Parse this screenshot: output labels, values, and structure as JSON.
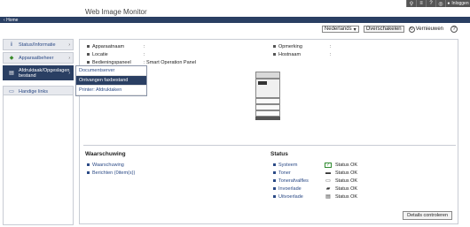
{
  "header": {
    "title": "Web Image Monitor",
    "login_label": "Inloggen"
  },
  "breadcrumb": {
    "home_label": "Home"
  },
  "controls": {
    "language_value": "Nederlands",
    "switch_label": "Overschakelen",
    "refresh_label": "Vernieuwen"
  },
  "sidebar": {
    "items": [
      {
        "label": "Status/Informatie",
        "icon": "info-icon"
      },
      {
        "label": "Apparaatbeheer",
        "icon": "device-management-icon"
      },
      {
        "label": "Afdruktaak/Opgeslagen bestand",
        "icon": "print-job-icon"
      },
      {
        "label": "Handige links",
        "icon": "links-icon"
      }
    ]
  },
  "submenu": {
    "items": [
      {
        "label": "Documentserver"
      },
      {
        "label": "Ontvangen faxbestand"
      },
      {
        "label": "Printer: Afdruktaken"
      }
    ]
  },
  "device_info": {
    "left": [
      {
        "label": "Apparaatnaam",
        "value": ":"
      },
      {
        "label": "Locatie",
        "value": ":"
      },
      {
        "label": "Bedieningspaneel",
        "value": ": Smart Operation Panel"
      }
    ],
    "right": [
      {
        "label": "Opmerking",
        "value": ":"
      },
      {
        "label": "Hostnaam",
        "value": ":"
      }
    ]
  },
  "warning": {
    "title": "Waarschuwing",
    "items": [
      {
        "label": "Waarschuwing"
      },
      {
        "label": "Berichten (0item(s))"
      }
    ]
  },
  "status": {
    "title": "Status",
    "items": [
      {
        "name": "Systeem",
        "value": "Status OK",
        "icon": "ok-check-icon"
      },
      {
        "name": "Toner",
        "value": "Status OK",
        "icon": "toner-icon"
      },
      {
        "name": "Tonerafvalfles",
        "value": "Status OK",
        "icon": "waste-toner-icon"
      },
      {
        "name": "Invoerlade",
        "value": "Status OK",
        "icon": "input-tray-icon"
      },
      {
        "name": "Uitvoerlade",
        "value": "Status OK",
        "icon": "output-tray-icon"
      }
    ],
    "details_label": "Details controleren"
  },
  "colors": {
    "nav_dark": "#2a3f63",
    "link_blue": "#2b4a86",
    "ok_green": "#2f8a2f"
  }
}
